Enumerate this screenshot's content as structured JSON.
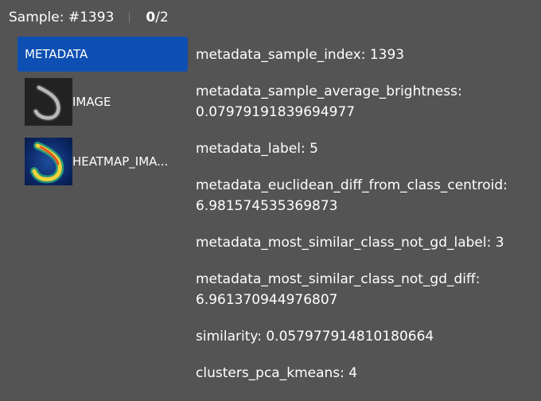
{
  "header": {
    "sample_label": "Sample: #1393",
    "count_current": "0",
    "count_total": "/2"
  },
  "sidebar": {
    "items": [
      {
        "label": "METADATA",
        "active": true
      },
      {
        "label": "IMAGE",
        "thumbnail": "digit-image-thumbnail"
      },
      {
        "label": "HEATMAP_IMA...",
        "thumbnail": "heatmap-image-thumbnail"
      }
    ]
  },
  "metadata": [
    {
      "key": "metadata_sample_index:",
      "value": "1393"
    },
    {
      "key": "metadata_sample_average_brightness:",
      "value": "0.07979191839694977"
    },
    {
      "key": "metadata_label:",
      "value": "5"
    },
    {
      "key": "metadata_euclidean_diff_from_class_centroid:",
      "value": "6.981574535369873"
    },
    {
      "key": "metadata_most_similar_class_not_gd_label:",
      "value": "3"
    },
    {
      "key": "metadata_most_similar_class_not_gd_diff:",
      "value": "6.961370944976807"
    },
    {
      "key": "similarity:",
      "value": "0.057977914810180664"
    },
    {
      "key": "clusters_pca_kmeans:",
      "value": "4"
    }
  ],
  "colors": {
    "background": "#545454",
    "active_tab": "#0d4fb3",
    "text": "#ffffff"
  }
}
